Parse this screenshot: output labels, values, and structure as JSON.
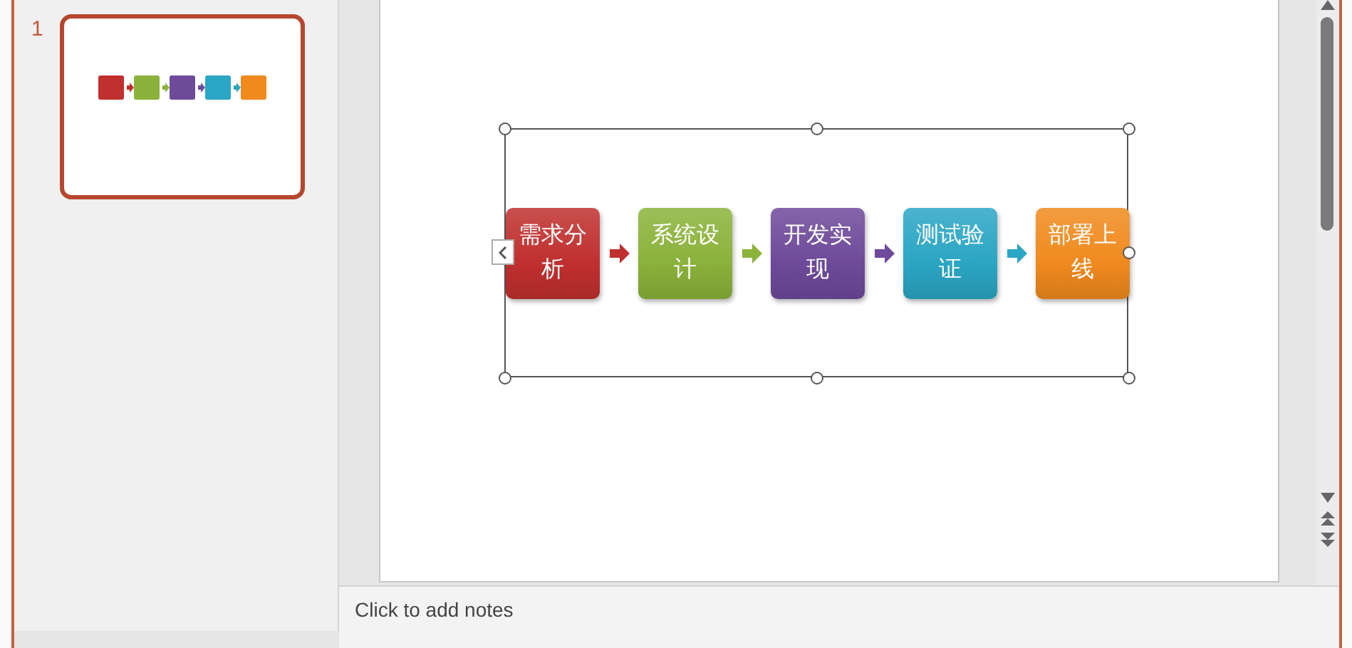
{
  "slides_pane": {
    "slide_number": "1",
    "selected": true
  },
  "steps": [
    {
      "label": "需求分析",
      "color": "#c0302f"
    },
    {
      "label": "系统设计",
      "color": "#8bb23a"
    },
    {
      "label": "开发实现",
      "color": "#6e4a9a"
    },
    {
      "label": "测试验证",
      "color": "#2ba6c4"
    },
    {
      "label": "部署上线",
      "color": "#f08a1e"
    }
  ],
  "notes": {
    "placeholder": "Click to add notes"
  }
}
